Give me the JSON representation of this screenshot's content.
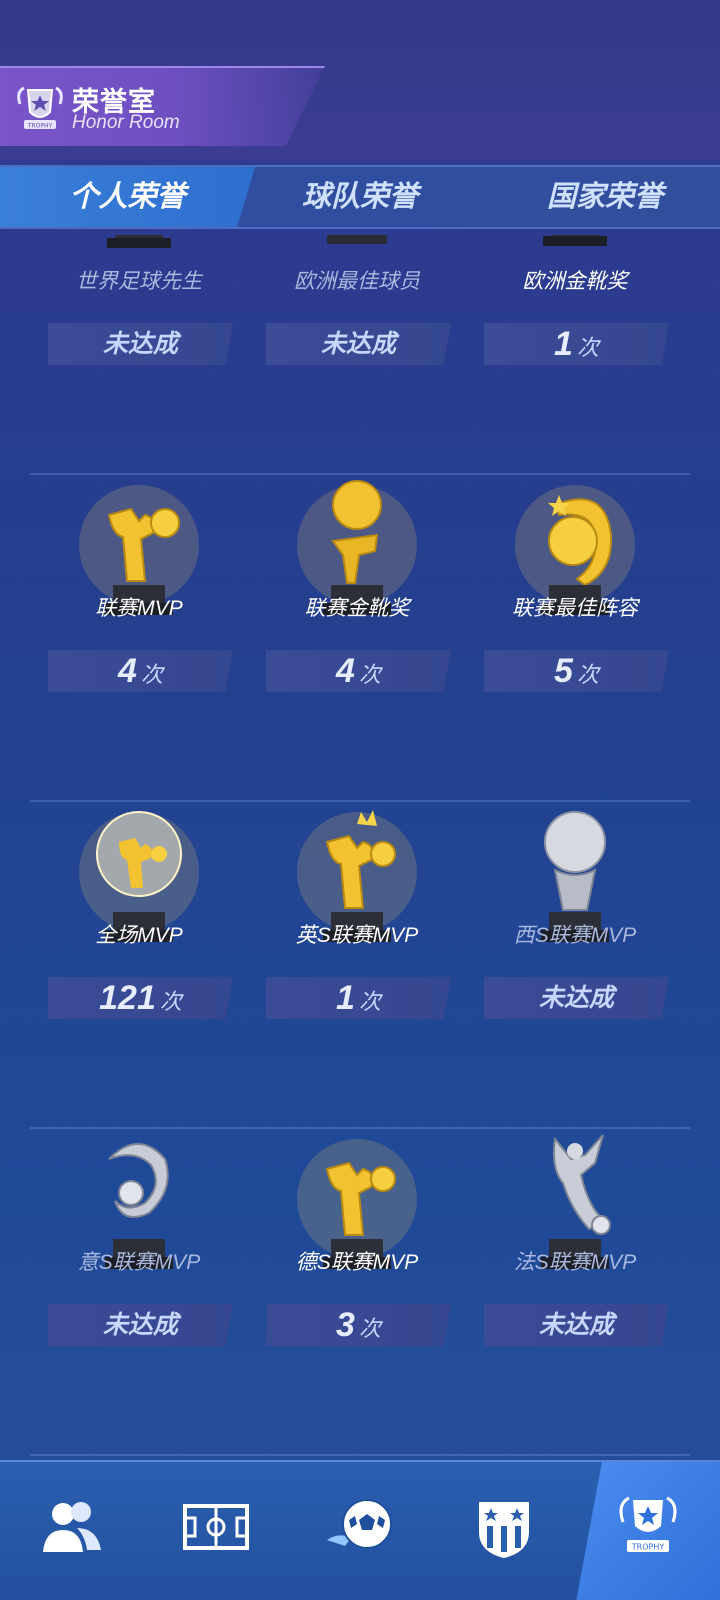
{
  "header": {
    "title_cn": "荣誉室",
    "title_en": "Honor Room"
  },
  "tabs": [
    {
      "label": "个人荣誉",
      "active": true
    },
    {
      "label": "球队荣誉",
      "active": false
    },
    {
      "label": "国家荣誉",
      "active": false
    }
  ],
  "honors": [
    {
      "name": "世界足球先生",
      "status": "未达成",
      "achieved": false,
      "trophy": "silver-cup-icon"
    },
    {
      "name": "欧洲最佳球员",
      "status": "未达成",
      "achieved": false,
      "trophy": "silver-cup-icon"
    },
    {
      "name": "欧洲金靴奖",
      "count": "1",
      "unit": "次",
      "achieved": true,
      "trophy": "golden-boot-icon"
    },
    {
      "name": "联赛MVP",
      "count": "4",
      "unit": "次",
      "achieved": true,
      "trophy": "gold-player-icon"
    },
    {
      "name": "联赛金靴奖",
      "count": "4",
      "unit": "次",
      "achieved": true,
      "trophy": "gold-ball-boot-icon"
    },
    {
      "name": "联赛最佳阵容",
      "count": "5",
      "unit": "次",
      "achieved": true,
      "trophy": "gold-star-ball-icon"
    },
    {
      "name": "全场MVP",
      "count": "121",
      "unit": "次",
      "achieved": true,
      "trophy": "crystal-ball-icon"
    },
    {
      "name": "英S联赛MVP",
      "count": "1",
      "unit": "次",
      "achieved": true,
      "trophy": "gold-crown-player-icon"
    },
    {
      "name": "西S联赛MVP",
      "status": "未达成",
      "achieved": false,
      "trophy": "silver-ball-icon"
    },
    {
      "name": "意S联赛MVP",
      "status": "未达成",
      "achieved": false,
      "trophy": "silver-swirl-icon"
    },
    {
      "name": "德S联赛MVP",
      "count": "3",
      "unit": "次",
      "achieved": true,
      "trophy": "gold-player-icon"
    },
    {
      "name": "法S联赛MVP",
      "status": "未达成",
      "achieved": false,
      "trophy": "silver-figure-icon"
    }
  ],
  "bottom_nav": [
    {
      "icon": "players-icon",
      "active": false
    },
    {
      "icon": "pitch-icon",
      "active": false
    },
    {
      "icon": "soccer-ball-icon",
      "active": false
    },
    {
      "icon": "club-badge-icon",
      "active": false
    },
    {
      "icon": "trophy-badge-icon",
      "active": true
    }
  ],
  "colors": {
    "gold": "#f2c230",
    "silver": "#c8ccd6",
    "accent": "#3a7fd8"
  }
}
